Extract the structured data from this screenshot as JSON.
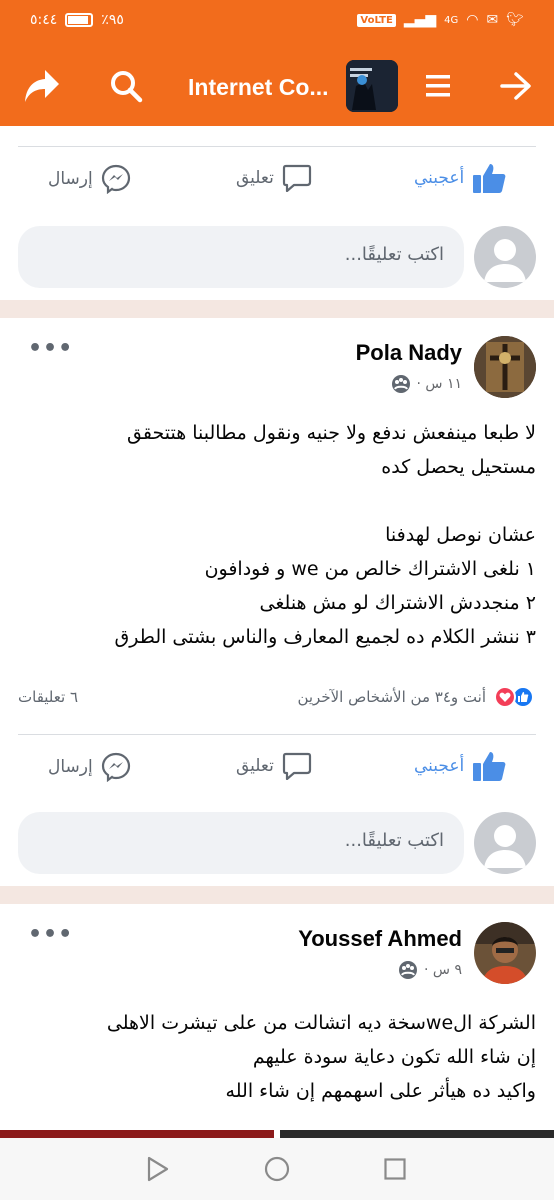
{
  "status_bar": {
    "battery_percent": "٪٩٥",
    "time": "٥:٤٤",
    "network": "4G",
    "volte": "VoLTE"
  },
  "app_bar": {
    "title": "Internet Co..."
  },
  "actions": {
    "like": "أعجبني",
    "comment": "تعليق",
    "send": "إرسال"
  },
  "comment_placeholder": "اكتب تعليقًا...",
  "posts": [
    {
      "author": "Pola Nady",
      "time": "١١ س ·",
      "text": "لا طبعا مينفعش ندفع ولا جنيه ونقول مطالبنا هتتحقق\nمستحيل يحصل كده\n\nعشان نوصل لهدفنا\n١  نلغى الاشتراك خالص من we و فودافون\n٢  منجددش الاشتراك لو مش هنلغى\n٣  ننشر الكلام ده لجميع المعارف والناس بشتى الطرق",
      "reactions_text": "أنت و٣٤ من الأشخاص الآخرين",
      "comments_count": "٦ تعليقات"
    },
    {
      "author": "Youssef Ahmed",
      "time": "٩ س ·",
      "text": "الشركة الweسخة ديه اتشالت من على تيشرت الاهلى\nإن شاء الله تكون دعاية سودة عليهم\nواكيد ده هيأثر على اسهمهم إن شاء الله"
    }
  ],
  "colors": {
    "brand": "#f26c1c",
    "like_blue": "#4b8ee6",
    "divider": "#f4e7e1"
  }
}
